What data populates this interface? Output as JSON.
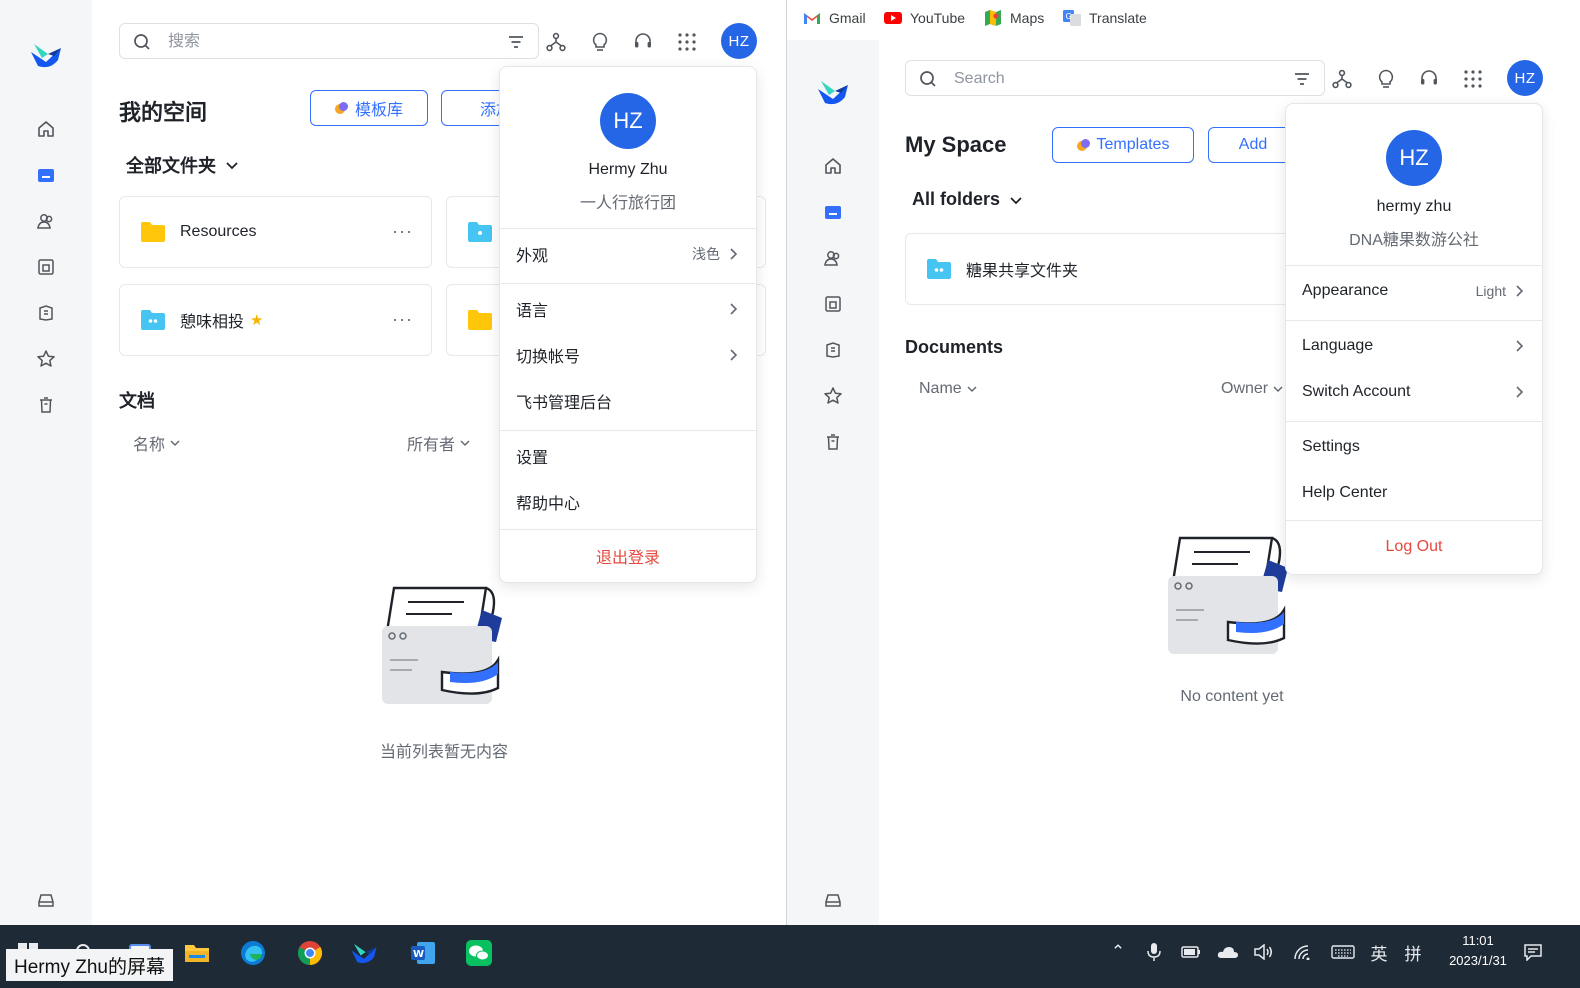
{
  "left": {
    "search": {
      "placeholder": "搜索"
    },
    "avatar": "HZ",
    "page_title": "我的空间",
    "templates_button": "模板库",
    "add_button": "添加",
    "folders_title": "全部文件夹",
    "folders": [
      {
        "name": "Resources",
        "more": "···"
      },
      {
        "name": "憩味相投",
        "more": "···"
      }
    ],
    "documents_title": "文档",
    "columns": {
      "name": "名称",
      "owner": "所有者"
    },
    "empty_text": "当前列表暂无内容",
    "menu": {
      "avatar": "HZ",
      "name": "Hermy Zhu",
      "org": "一人行旅行团",
      "appearance": "外观",
      "appearance_value": "浅色",
      "language": "语言",
      "switch_account": "切换帐号",
      "admin": "飞书管理后台",
      "settings": "设置",
      "help": "帮助中心",
      "logout": "退出登录"
    }
  },
  "right": {
    "bookmarks": [
      {
        "label": "Gmail",
        "icon": "gmail-icon"
      },
      {
        "label": "YouTube",
        "icon": "youtube-icon"
      },
      {
        "label": "Maps",
        "icon": "maps-icon"
      },
      {
        "label": "Translate",
        "icon": "translate-icon"
      }
    ],
    "search": {
      "placeholder": "Search"
    },
    "avatar": "HZ",
    "page_title": "My Space",
    "templates_button": "Templates",
    "add_button": "Add",
    "folders_title": "All folders",
    "folders": [
      {
        "name": "糖果共享文件夹"
      }
    ],
    "documents_title": "Documents",
    "columns": {
      "name": "Name",
      "owner": "Owner"
    },
    "empty_text": "No content yet",
    "menu": {
      "avatar": "HZ",
      "name": "hermy zhu",
      "org": "DNA糖果数游公社",
      "appearance": "Appearance",
      "appearance_value": "Light",
      "language": "Language",
      "switch_account": "Switch Account",
      "settings": "Settings",
      "help": "Help Center",
      "logout": "Log Out"
    }
  },
  "taskbar": {
    "time": "11:01",
    "date": "2023/1/31",
    "ime_lang": "英",
    "ime_mode": "拼"
  },
  "caption": "Hermy Zhu的屏幕",
  "colors": {
    "accent": "#3370ff",
    "avatar": "#2566e6",
    "logout": "#e5493e",
    "taskbar": "#1e2a36"
  }
}
